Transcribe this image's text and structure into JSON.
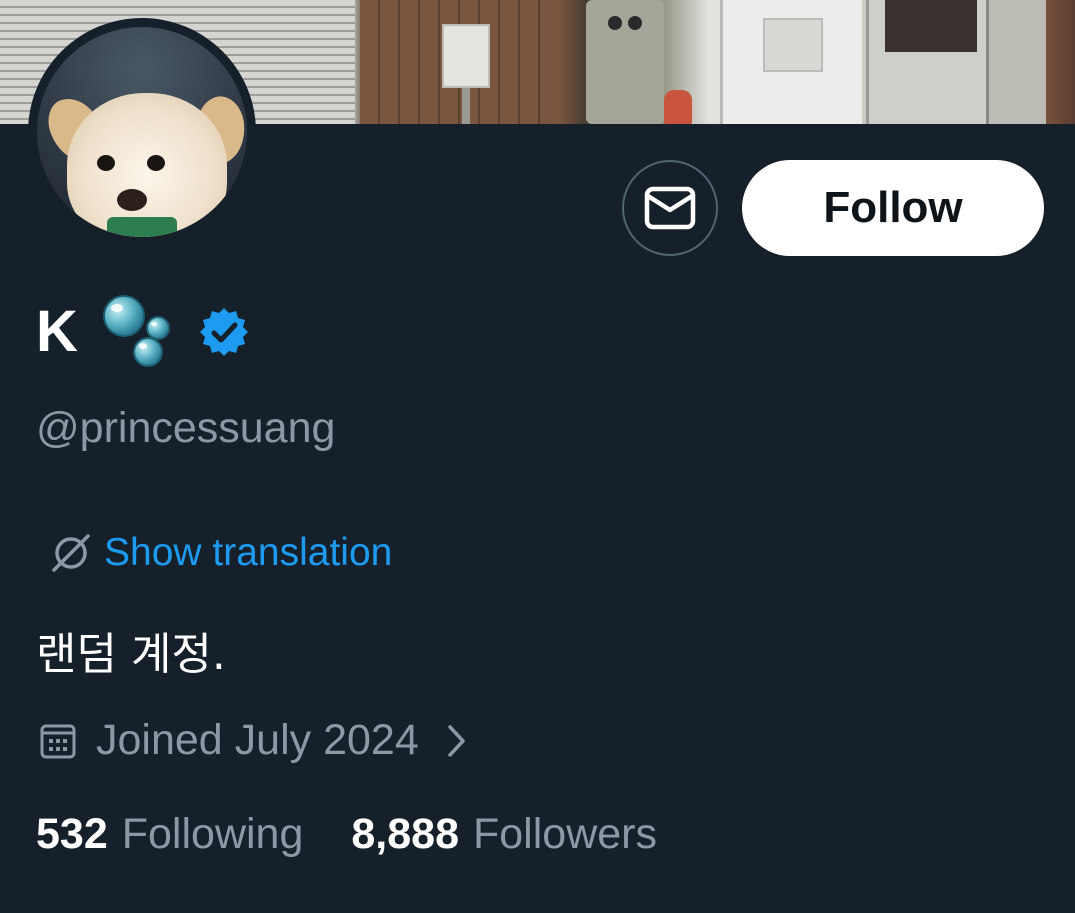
{
  "profile": {
    "display_name": "K",
    "name_emoji_icon": "bubbles-icon",
    "verified_icon": "verified-badge-icon",
    "handle": "@princessuang",
    "bio": "랜덤 계정.",
    "joined": "Joined July 2024"
  },
  "actions": {
    "message_icon": "envelope-icon",
    "follow_label": "Follow"
  },
  "translation": {
    "icon": "globe-slash-icon",
    "label": "Show translation"
  },
  "stats": {
    "following_count": "532",
    "following_label": "Following",
    "followers_count": "8,888",
    "followers_label": "Followers"
  },
  "colors": {
    "background": "#15202b",
    "primary_text": "#ffffff",
    "secondary_text": "#8b98a5",
    "link": "#1d9bf0",
    "verified": "#1d9bf0"
  }
}
